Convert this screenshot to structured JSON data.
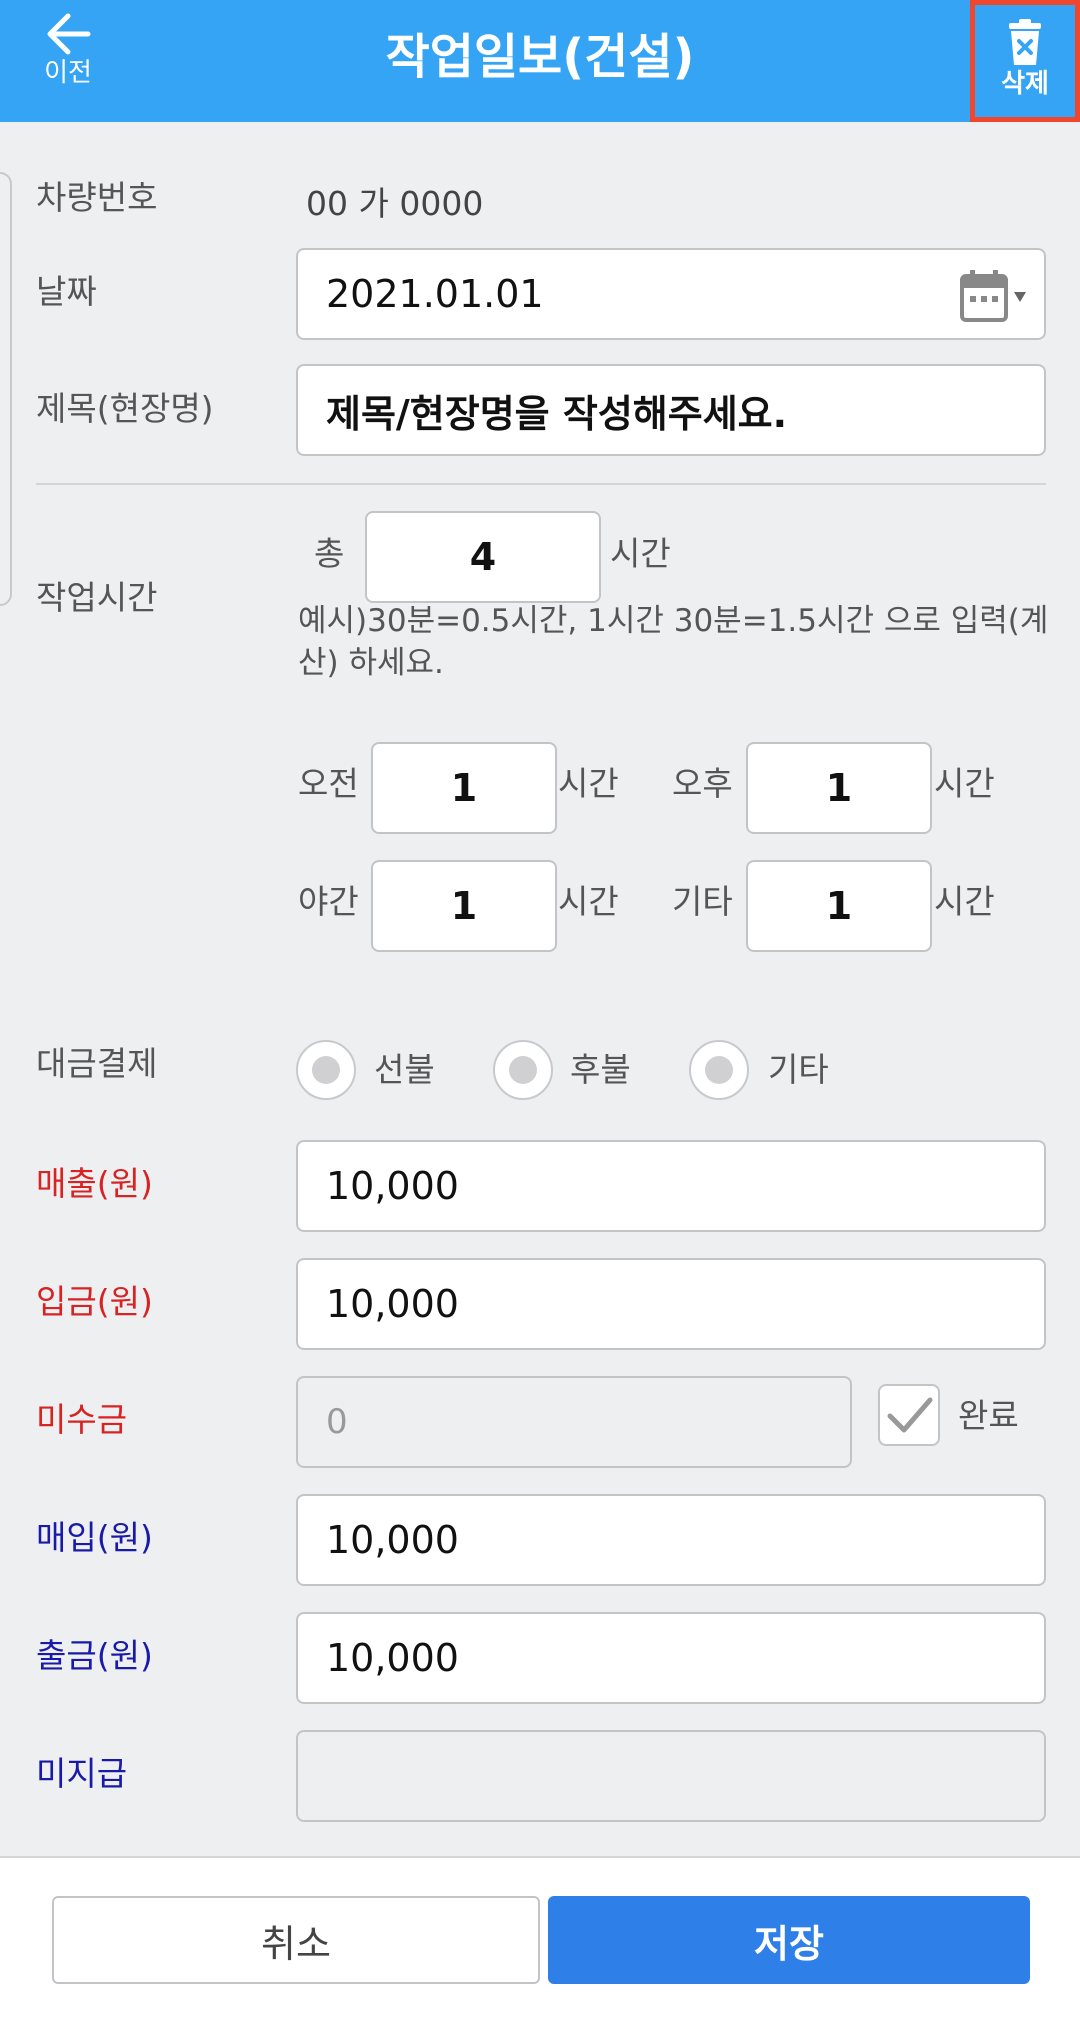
{
  "header": {
    "back_label": "이전",
    "title": "작업일보(건설)",
    "delete_label": "삭제"
  },
  "vehicle": {
    "label": "차량번호",
    "value": "00 가 0000"
  },
  "date": {
    "label": "날짜",
    "value": "2021.01.01"
  },
  "subject": {
    "label": "제목(현장명)",
    "placeholder": "제목/현장명을 작성해주세요."
  },
  "work_time": {
    "label": "작업시간",
    "total_prefix": "총",
    "total": "4",
    "unit": "시간",
    "hint": "예시)30분=0.5시간, 1시간 30분=1.5시간 으로 입력(계산) 하세요.",
    "morning_label": "오전",
    "morning": "1",
    "afternoon_label": "오후",
    "afternoon": "1",
    "night_label": "야간",
    "night": "1",
    "other_label": "기타",
    "other": "1"
  },
  "payment": {
    "label": "대금결제",
    "options": [
      "선불",
      "후불",
      "기타"
    ]
  },
  "sales": {
    "label": "매출(원)",
    "value": "10,000"
  },
  "deposit": {
    "label": "입금(원)",
    "value": "10,000"
  },
  "receivable": {
    "label": "미수금",
    "value": "0",
    "done_label": "완료",
    "done_checked": true
  },
  "purchase": {
    "label": "매입(원)",
    "value": "10,000"
  },
  "withdrawal": {
    "label": "출금(원)",
    "value": "10,000"
  },
  "unpaid": {
    "label": "미지급",
    "value": ""
  },
  "actions": {
    "cancel": "취소",
    "save": "저장"
  },
  "colors": {
    "header": "#35a4f5",
    "save": "#2f7fe8",
    "income_label": "#d82323",
    "expense_label": "#1a1aa8"
  }
}
